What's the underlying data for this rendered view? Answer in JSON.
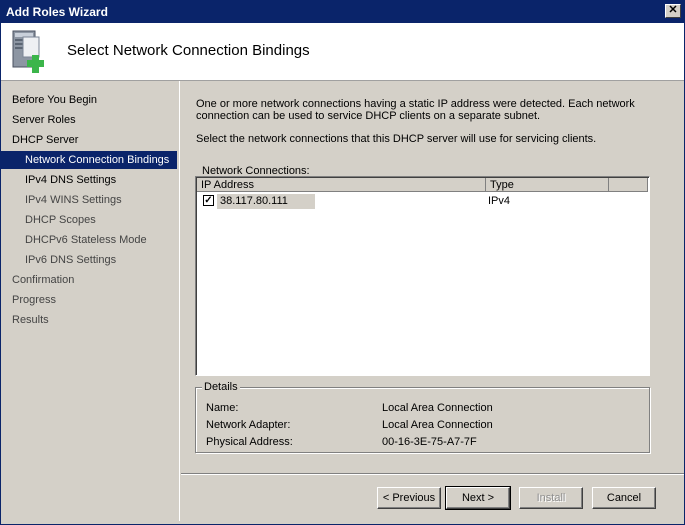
{
  "window": {
    "title": "Add Roles Wizard",
    "close_glyph": "✕"
  },
  "header": {
    "title": "Select Network Connection Bindings",
    "icon": "server-add-icon"
  },
  "nav": {
    "items": [
      {
        "label": "Before You Begin"
      },
      {
        "label": "Server Roles"
      },
      {
        "label": "DHCP Server"
      },
      {
        "label": "Network Connection Bindings"
      },
      {
        "label": "IPv4 DNS Settings"
      },
      {
        "label": "IPv4 WINS Settings"
      },
      {
        "label": "DHCP Scopes"
      },
      {
        "label": "DHCPv6 Stateless Mode"
      },
      {
        "label": "IPv6 DNS Settings"
      },
      {
        "label": "Confirmation"
      },
      {
        "label": "Progress"
      },
      {
        "label": "Results"
      }
    ]
  },
  "main": {
    "description": "One or more network connections having a static IP address were detected. Each network connection can be used to service DHCP clients on a separate subnet.",
    "instruction": "Select the network connections that this DHCP server will use for servicing clients.",
    "connections_label": "Network Connections:",
    "columns": [
      "IP Address",
      "Type"
    ],
    "rows": [
      {
        "checked": true,
        "check_glyph": "✓",
        "ip": "38.117.80.111",
        "type": "IPv4"
      }
    ],
    "details": {
      "legend": "Details",
      "name_label": "Name:",
      "name_value": "Local Area Connection",
      "adapter_label": "Network Adapter:",
      "adapter_value": "Local Area Connection",
      "address_label": "Physical Address:",
      "address_value": "00-16-3E-75-A7-7F"
    }
  },
  "buttons": {
    "previous": "< Previous",
    "next": "Next >",
    "install": "Install",
    "cancel": "Cancel"
  },
  "colors": {
    "title_bar": "#0a246a",
    "face": "#d4d0c8",
    "selection": "#0a246a"
  }
}
